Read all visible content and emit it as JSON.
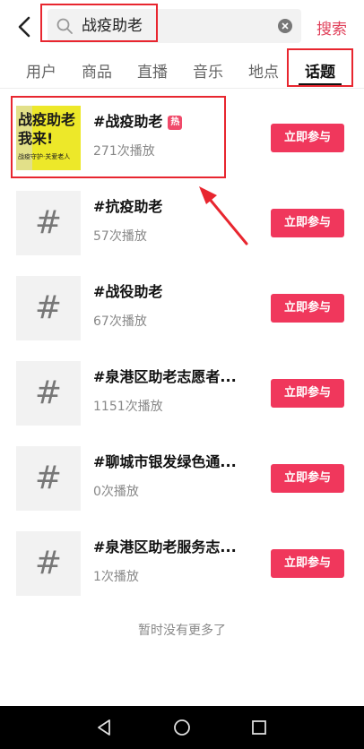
{
  "search": {
    "query": "战疫助老",
    "button_label": "搜索"
  },
  "tabs": [
    {
      "label": "用户",
      "active": false
    },
    {
      "label": "商品",
      "active": false
    },
    {
      "label": "直播",
      "active": false
    },
    {
      "label": "音乐",
      "active": false
    },
    {
      "label": "地点",
      "active": false
    },
    {
      "label": "话题",
      "active": true
    }
  ],
  "topics": [
    {
      "title": "#战疫助老",
      "plays": "271次播放",
      "hot_badge": "热",
      "button": "立即参与",
      "thumb_lines": [
        "战疫助老",
        "我来!",
        "战疫守护·关爱老人"
      ]
    },
    {
      "title": "#抗疫助老",
      "plays": "57次播放",
      "button": "立即参与"
    },
    {
      "title": "#战役助老",
      "plays": "67次播放",
      "button": "立即参与"
    },
    {
      "title": "#泉港区助老志愿者...",
      "plays": "1151次播放",
      "button": "立即参与"
    },
    {
      "title": "#聊城市银发绿色通...",
      "plays": "0次播放",
      "button": "立即参与"
    },
    {
      "title": "#泉港区助老服务志...",
      "plays": "1次播放",
      "button": "立即参与"
    }
  ],
  "footer": "暂时没有更多了",
  "colors": {
    "accent": "#f0375c",
    "search_accent": "#e0405a",
    "annotation": "#e8262f"
  }
}
